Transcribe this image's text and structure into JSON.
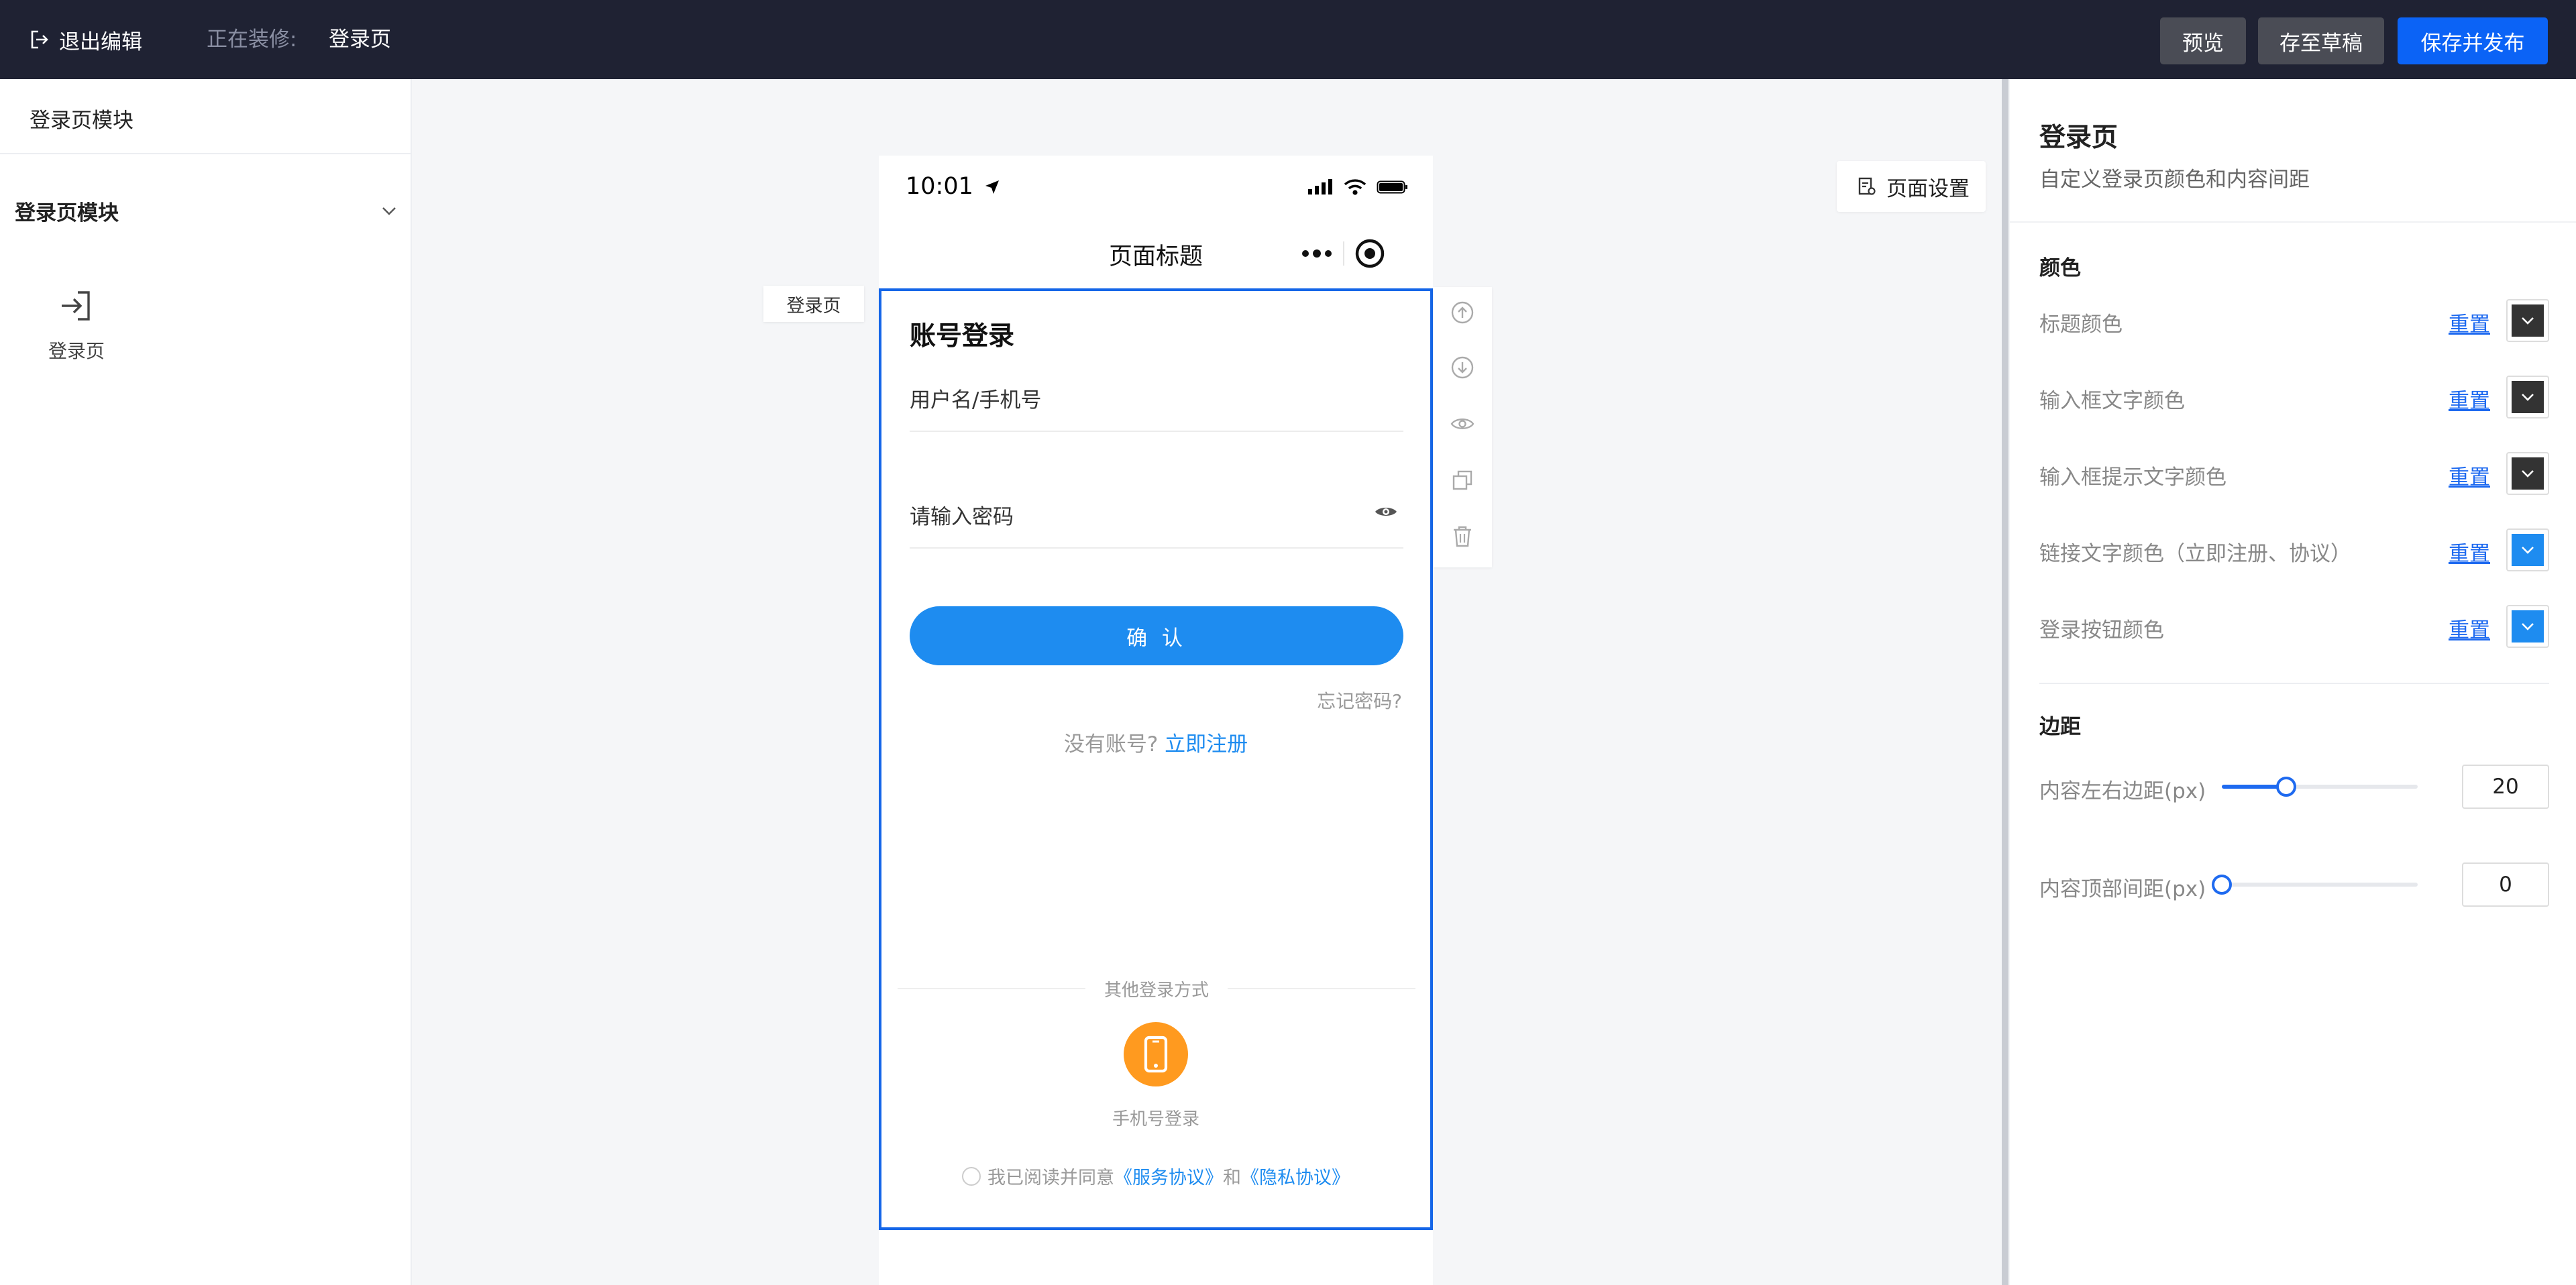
{
  "topbar": {
    "exit_label": "退出编辑",
    "editing_label": "正在装修:",
    "editing_page": "登录页",
    "preview_label": "预览",
    "draft_label": "存至草稿",
    "publish_label": "保存并发布"
  },
  "left_panel": {
    "title": "登录页模块",
    "group_label": "登录页模块",
    "module_label": "登录页"
  },
  "canvas": {
    "page_settings_label": "页面设置",
    "component_tag": "登录页",
    "phone": {
      "time": "10:01",
      "nav_title": "页面标题",
      "login_title": "账号登录",
      "username_placeholder": "用户名/手机号",
      "password_placeholder": "请输入密码",
      "confirm_label": "确 认",
      "forgot_label": "忘记密码?",
      "no_account_label": "没有账号?",
      "register_label": "立即注册",
      "other_login_label": "其他登录方式",
      "phone_login_label": "手机号登录",
      "agree_prefix": "我已阅读并同意",
      "service_agreement": "《服务协议》",
      "and_label": "和",
      "privacy_agreement": "《隐私协议》"
    }
  },
  "right_panel": {
    "title": "登录页",
    "description": "自定义登录页颜色和内容间距",
    "color_section": "颜色",
    "reset_label": "重置",
    "colors": [
      {
        "label": "标题颜色",
        "value": "#333333"
      },
      {
        "label": "输入框文字颜色",
        "value": "#333333"
      },
      {
        "label": "输入框提示文字颜色",
        "value": "#333333"
      },
      {
        "label": "链接文字颜色（立即注册、协议）",
        "value": "#1e8cf0"
      },
      {
        "label": "登录按钮颜色",
        "value": "#1e8cf0"
      }
    ],
    "margin_section": "边距",
    "sliders": [
      {
        "label": "内容左右边距(px)",
        "value": "20",
        "fraction": 0.33
      },
      {
        "label": "内容顶部间距(px)",
        "value": "0",
        "fraction": 0.0
      }
    ]
  },
  "theme": {
    "accent": "#1e6af0",
    "primary_button": "#0b63f6",
    "topbar_bg": "#1f2233",
    "phone_login_icon_bg": "#ff9a1f"
  }
}
